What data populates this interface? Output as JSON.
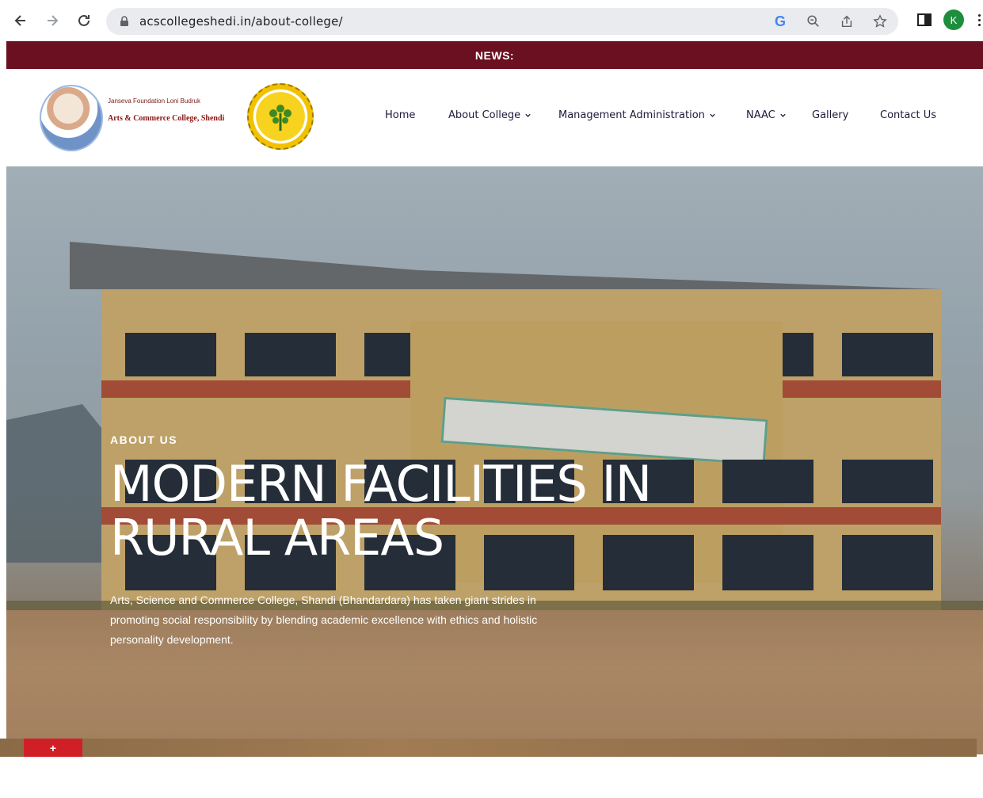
{
  "browser": {
    "url": "acscollegeshedi.in/about-college/",
    "avatar_letter": "K",
    "google_letter": "G"
  },
  "news": {
    "label": "NEWS:"
  },
  "logo": {
    "line1": "Janseva Foundation Loni Budruk",
    "line2": "Arts & Commerce College, Shendi"
  },
  "menu": {
    "items": [
      {
        "label": "Home",
        "has_dropdown": false
      },
      {
        "label": "About College",
        "has_dropdown": true
      },
      {
        "label": "Management Administration",
        "has_dropdown": true
      },
      {
        "label": "NAAC",
        "has_dropdown": true
      },
      {
        "label": "Gallery",
        "has_dropdown": false
      },
      {
        "label": "Contact Us",
        "has_dropdown": false
      }
    ]
  },
  "hero": {
    "eyebrow": "ABOUT US",
    "title_line1": "MODERN FACILITIES IN",
    "title_line2": "RURAL AREAS",
    "description": "Arts, Science and Commerce College, Shandi (Bhandardara) has taken giant strides in promoting social responsibility by blending academic excellence with ethics and holistic personality development."
  },
  "next_section": {
    "tab_symbol": "+"
  },
  "colors": {
    "news_bar": "#6b1020",
    "menu_text": "#1a1a3a",
    "accent_red": "#d11f28"
  }
}
